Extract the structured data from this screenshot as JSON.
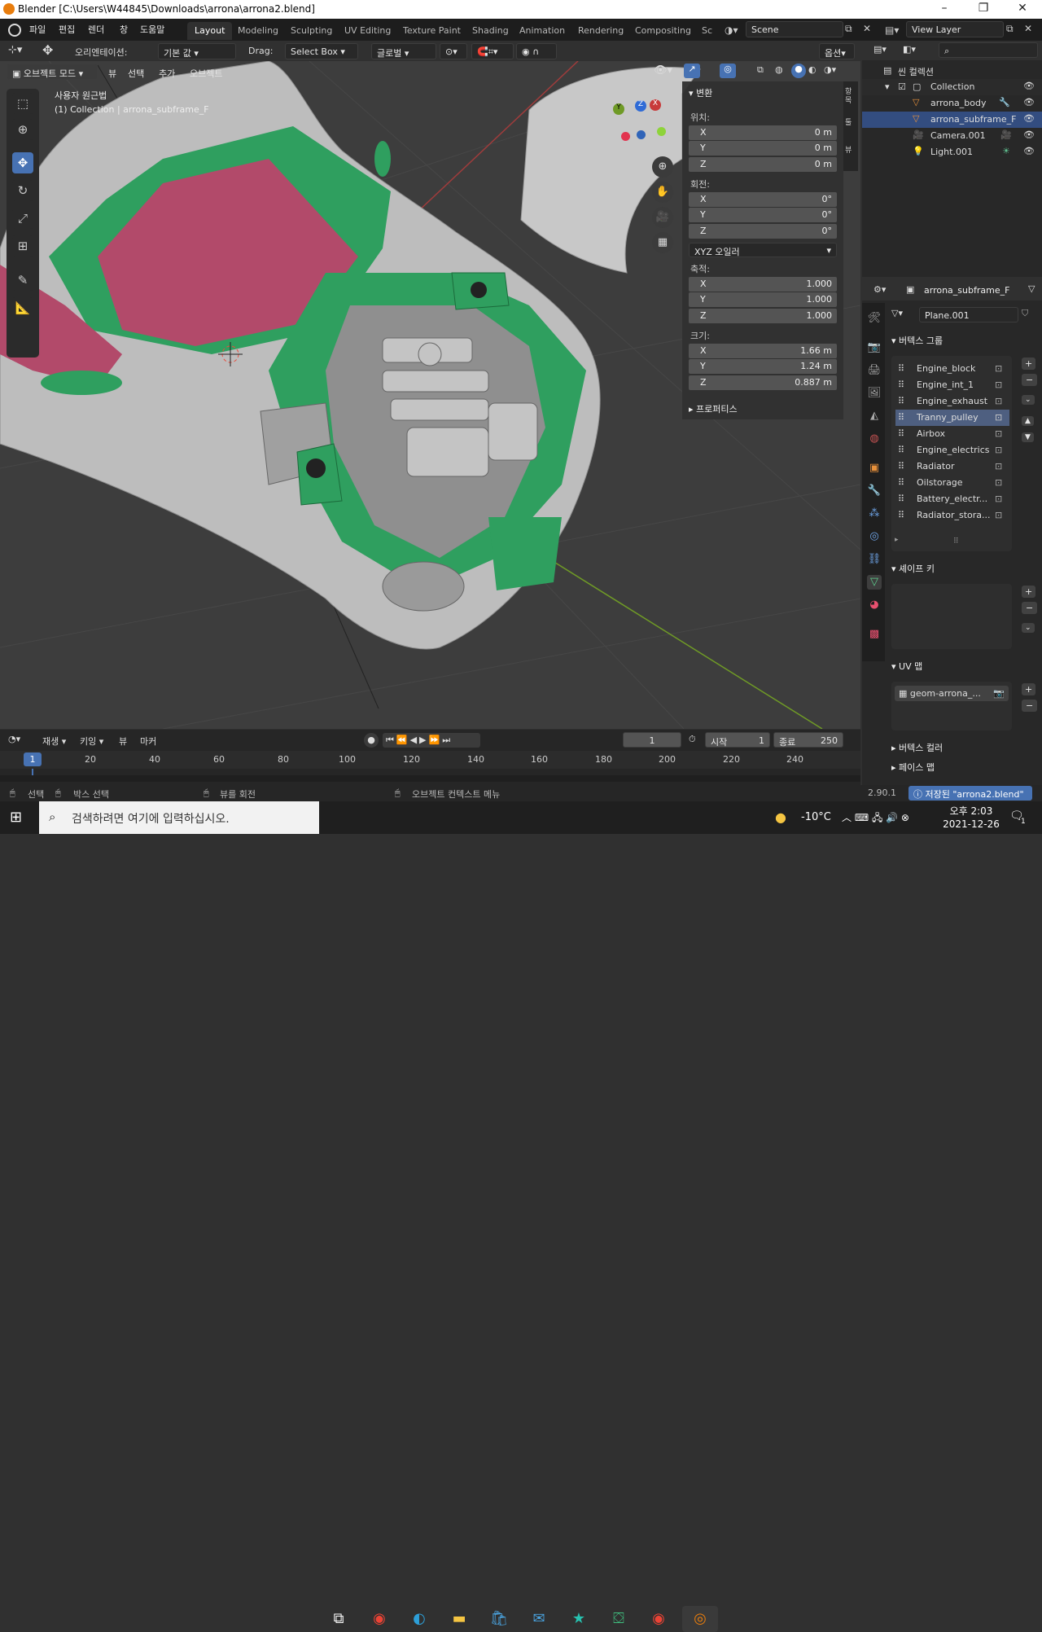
{
  "window_title": "Blender [C:\\Users\\W44845\\Downloads\\arrona\\arrona2.blend]",
  "menus": [
    "파일",
    "편집",
    "렌더",
    "창",
    "도움말"
  ],
  "workspaces": [
    "Layout",
    "Modeling",
    "Sculpting",
    "UV Editing",
    "Texture Paint",
    "Shading",
    "Animation",
    "Rendering",
    "Compositing",
    "Sc"
  ],
  "scene_name": "Scene",
  "view_layer": "View Layer",
  "toolbar": {
    "orientation_label": "오리엔테이션:",
    "orientation_value": "기본 값",
    "drag_label": "Drag:",
    "drag_value": "Select Box",
    "transform_global": "글로벌",
    "options": "옵션"
  },
  "viewport_header": {
    "mode": "오브젝트 모드",
    "view": "뷰",
    "select": "선택",
    "add": "추가",
    "object": "오브젝트"
  },
  "viewport_info": {
    "line1": "사용자 원근법",
    "line2": "(1) Collection | arrona_subframe_F"
  },
  "gizmo": {
    "x": "X",
    "y": "Y",
    "z": "Z"
  },
  "npanel": {
    "header": "변환",
    "location_label": "위치:",
    "location": [
      {
        "axis": "X",
        "value": "0 m"
      },
      {
        "axis": "Y",
        "value": "0 m"
      },
      {
        "axis": "Z",
        "value": "0 m"
      }
    ],
    "rotation_label": "회전:",
    "rotation": [
      {
        "axis": "X",
        "value": "0°"
      },
      {
        "axis": "Y",
        "value": "0°"
      },
      {
        "axis": "Z",
        "value": "0°"
      }
    ],
    "rotation_mode": "XYZ 오일러",
    "scale_label": "축적:",
    "scale": [
      {
        "axis": "X",
        "value": "1.000"
      },
      {
        "axis": "Y",
        "value": "1.000"
      },
      {
        "axis": "Z",
        "value": "1.000"
      }
    ],
    "dimensions_label": "크기:",
    "dimensions": [
      {
        "axis": "X",
        "value": "1.66 m"
      },
      {
        "axis": "Y",
        "value": "1.24 m"
      },
      {
        "axis": "Z",
        "value": "0.887 m"
      }
    ],
    "properties": "프로퍼티스",
    "side_tabs": [
      "항목",
      "툴",
      "뷰"
    ]
  },
  "outliner": {
    "scene_collection": "씬 컬렉션",
    "items": [
      {
        "name": "Collection",
        "icon": "collection-icon"
      },
      {
        "name": "arrona_body",
        "icon": "mesh-icon"
      },
      {
        "name": "arrona_subframe_F",
        "icon": "mesh-icon"
      },
      {
        "name": "Camera.001",
        "icon": "camera-icon"
      },
      {
        "name": "Light.001",
        "icon": "light-icon"
      }
    ]
  },
  "properties": {
    "object_name": "arrona_subframe_F",
    "mesh_name": "Plane.001",
    "vertex_groups_header": "버텍스 그룹",
    "vertex_groups": [
      "Engine_block",
      "Engine_int_1",
      "Engine_exhaust",
      "Tranny_pulley",
      "Airbox",
      "Engine_electrics",
      "Radiator",
      "Oilstorage",
      "Battery_electr...",
      "Radiator_stora..."
    ],
    "selected_vg": "Tranny_pulley",
    "shape_keys_header": "셰이프 키",
    "uv_maps_header": "UV 맵",
    "uv_map": "geom-arrona_...",
    "vertex_colors_header": "버텍스 컬러",
    "face_maps_header": "페이스 맵"
  },
  "timeline": {
    "playback": "재생",
    "keying": "키잉",
    "view": "뷰",
    "marker": "마커",
    "current_frame": "1",
    "start_label": "시작",
    "start": "1",
    "end_label": "종료",
    "end": "250",
    "ruler": [
      "20",
      "40",
      "60",
      "80",
      "100",
      "120",
      "140",
      "160",
      "180",
      "200",
      "220",
      "240"
    ],
    "playhead": "1"
  },
  "statusbar": {
    "select": "선택",
    "box_select": "박스 선택",
    "rotate_view": "뷰를 회전",
    "context_menu": "오브젝트 컨텍스트 메뉴",
    "version": "2.90.1",
    "saved": "저장된 \"arrona2.blend\""
  },
  "taskbar": {
    "search_placeholder": "검색하려면 여기에 입력하십시오.",
    "temperature": "-10°C",
    "time": "오후 2:03",
    "date": "2021-12-26",
    "notif_count": "1"
  }
}
